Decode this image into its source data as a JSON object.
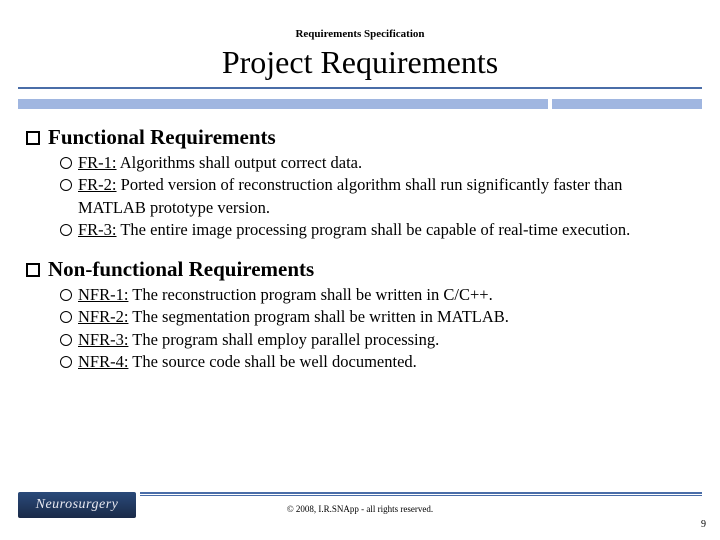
{
  "header": {
    "subtitle": "Requirements Specification",
    "title": "Project Requirements"
  },
  "sections": [
    {
      "heading": "Functional Requirements",
      "items": [
        {
          "label": "FR-1:",
          "text": " Algorithms shall output correct data."
        },
        {
          "label": "FR-2:",
          "text": " Ported version of reconstruction algorithm shall run significantly faster than MATLAB prototype version."
        },
        {
          "label": "FR-3:",
          "text": " The entire image processing program shall be capable of real-time execution."
        }
      ]
    },
    {
      "heading": "Non-functional Requirements",
      "items": [
        {
          "label": "NFR-1:",
          "text": " The reconstruction program shall be written in C/C++."
        },
        {
          "label": "NFR-2:",
          "text": " The segmentation program shall be written in MATLAB."
        },
        {
          "label": "NFR-3:",
          "text": " The program shall employ parallel processing."
        },
        {
          "label": "NFR-4:",
          "text": " The source code shall be well documented."
        }
      ]
    }
  ],
  "footer": {
    "logo_text": "Neurosurgery",
    "copyright": "© 2008, I.R.SNApp - all rights reserved.",
    "page_number": "9"
  }
}
